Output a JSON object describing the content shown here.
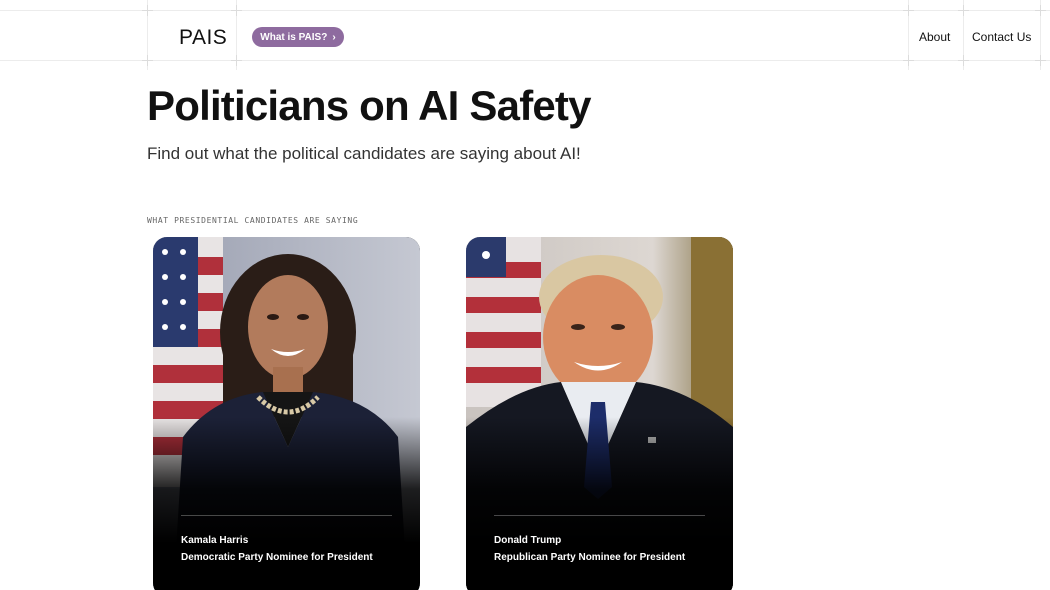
{
  "header": {
    "logo": "PAIS",
    "pill_label": "What is PAIS?",
    "pill_chevron": "›",
    "nav": [
      "About",
      "Contact Us"
    ]
  },
  "hero": {
    "title": "Politicians on AI Safety",
    "subtitle": "Find out what the political candidates are saying about AI!"
  },
  "section": {
    "label": "WHAT PRESIDENTIAL CANDIDATES ARE SAYING"
  },
  "candidates": [
    {
      "name": "Kamala Harris",
      "role": "Democratic Party Nominee for President"
    },
    {
      "name": "Donald Trump",
      "role": "Republican Party Nominee for President"
    }
  ],
  "colors": {
    "accent_pill": "#8e6b9f",
    "card_background": "#000000"
  }
}
